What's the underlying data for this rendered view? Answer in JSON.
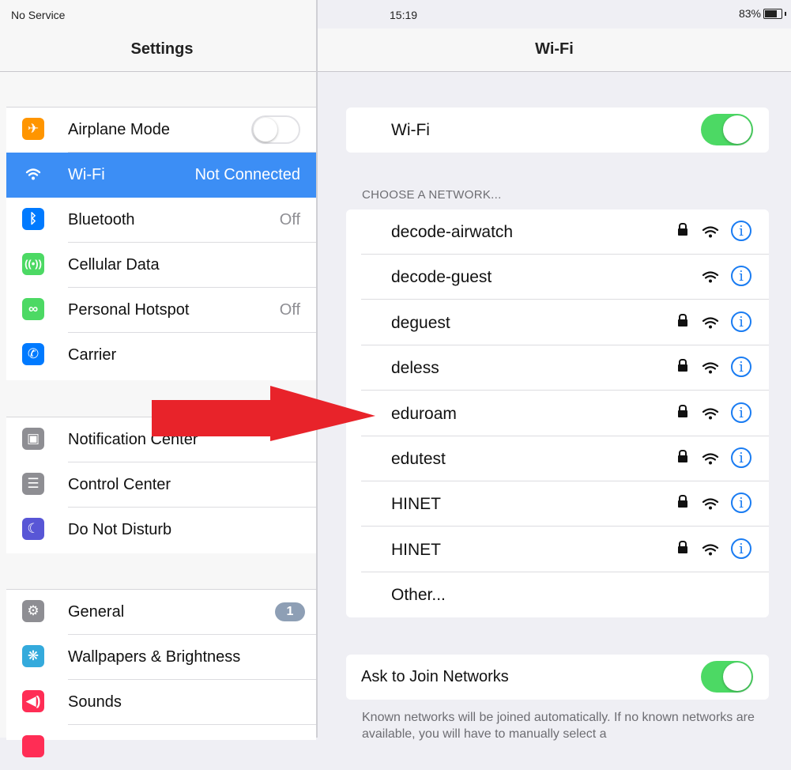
{
  "status_bar": {
    "carrier": "No Service",
    "time": "15:19",
    "battery": "83%",
    "battery_level": 0.83
  },
  "settings": {
    "title": "Settings",
    "groups": [
      {
        "items": [
          {
            "label": "Airplane Mode",
            "icon": "airplane-icon",
            "color": "#ff9500",
            "control": "toggle-off"
          },
          {
            "label": "Wi-Fi",
            "value": "Not Connected",
            "icon": "wifi-icon",
            "color": "#3c8ef5",
            "selected": true
          },
          {
            "label": "Bluetooth",
            "value": "Off",
            "icon": "bluetooth-icon",
            "color": "#007aff"
          },
          {
            "label": "Cellular Data",
            "icon": "cellular-icon",
            "color": "#4cd964"
          },
          {
            "label": "Personal Hotspot",
            "value": "Off",
            "icon": "hotspot-icon",
            "color": "#4cd964"
          },
          {
            "label": "Carrier",
            "icon": "phone-icon",
            "color": "#007aff"
          }
        ]
      },
      {
        "items": [
          {
            "label": "Notification Center",
            "icon": "notification-icon",
            "color": "#8e8e93"
          },
          {
            "label": "Control Center",
            "icon": "control-center-icon",
            "color": "#8e8e93"
          },
          {
            "label": "Do Not Disturb",
            "icon": "moon-icon",
            "color": "#5856d6"
          }
        ]
      },
      {
        "items": [
          {
            "label": "General",
            "icon": "gear-icon",
            "color": "#8e8e93",
            "badge": "1"
          },
          {
            "label": "Wallpapers & Brightness",
            "icon": "wallpaper-icon",
            "color": "#34aadc"
          },
          {
            "label": "Sounds",
            "icon": "speaker-icon",
            "color": "#ff2d55"
          }
        ]
      }
    ]
  },
  "wifi": {
    "title": "Wi-Fi",
    "toggle_label": "Wi-Fi",
    "toggle_on": true,
    "choose_label": "CHOOSE A NETWORK...",
    "networks": [
      {
        "name": "decode-airwatch",
        "locked": true
      },
      {
        "name": "decode-guest",
        "locked": false
      },
      {
        "name": "deguest",
        "locked": true
      },
      {
        "name": "deless",
        "locked": true
      },
      {
        "name": "eduroam",
        "locked": true
      },
      {
        "name": "edutest",
        "locked": true
      },
      {
        "name": "HINET",
        "locked": true
      },
      {
        "name": "HINET",
        "locked": true
      }
    ],
    "other_label": "Other...",
    "ask_label": "Ask to Join Networks",
    "ask_on": true,
    "footer": "Known networks will be joined automatically. If no known networks are available, you will have to manually select a"
  },
  "colors": {
    "accent": "#3c8ef5",
    "toggle_on": "#4cd964",
    "info": "#1a7cf2",
    "arrow": "#e8232a"
  }
}
